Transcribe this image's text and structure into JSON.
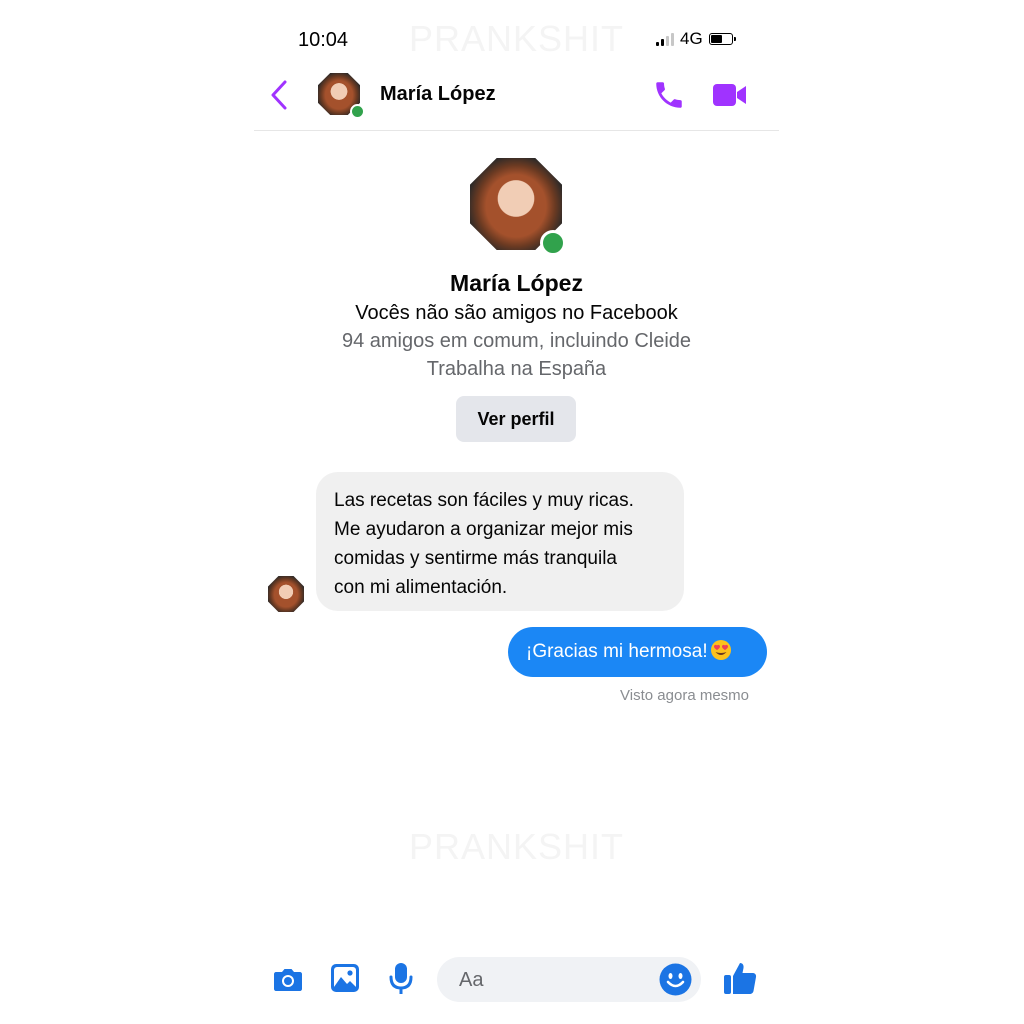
{
  "status_bar": {
    "time": "10:04",
    "network": "4G"
  },
  "watermark": {
    "text": "PRANKSHIT"
  },
  "header": {
    "contact_name": "María López",
    "accent_color": "#a033ff"
  },
  "profile": {
    "name": "María López",
    "friend_status": "Vocês não são amigos no Facebook",
    "mutual_friends": "94 amigos em comum, incluindo Cleide",
    "work": "Trabalha na España",
    "view_profile_label": "Ver perfil"
  },
  "messages": [
    {
      "direction": "incoming",
      "lines": [
        "Las recetas son fáciles y muy ricas.",
        "Me ayudaron a organizar mejor mis",
        "comidas y sentirme más tranquila",
        "con mi alimentación."
      ]
    },
    {
      "direction": "outgoing",
      "text": "¡Gracias mi hermosa!",
      "emoji": "smiling-face-with-heart-eyes",
      "color": "#1b87f5"
    }
  ],
  "seen_text": "Visto agora mesmo",
  "composer": {
    "placeholder": "Aa",
    "icon_color": "#1b74e4"
  }
}
